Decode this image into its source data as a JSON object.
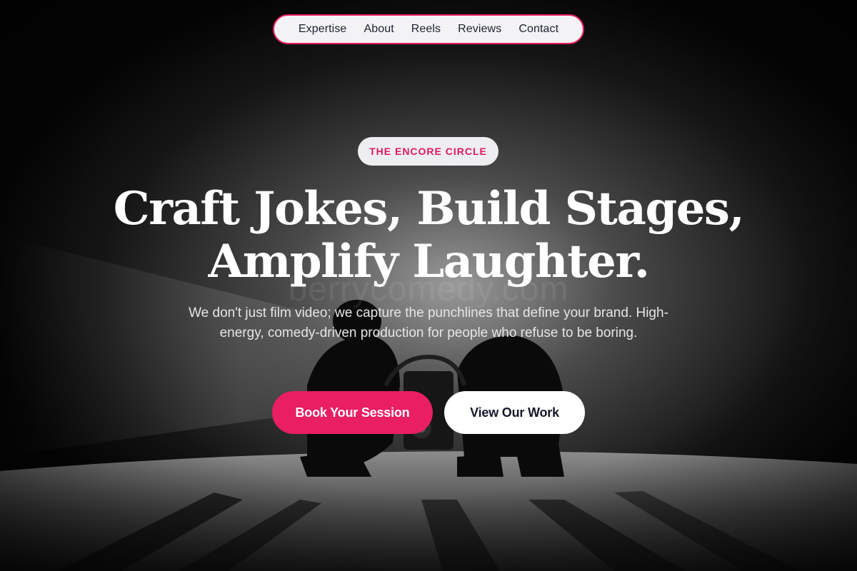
{
  "nav": {
    "links": [
      "Expertise",
      "About",
      "Reels",
      "Reviews",
      "Contact"
    ]
  },
  "hero": {
    "badge": "THE ENCORE CIRCLE",
    "headline_line1": "Craft Jokes, Build Stages,",
    "headline_line2": "Amplify Laughter.",
    "watermark": "berrycomedy.com",
    "subtitle": "We don't just film video; we capture the punchlines that define your brand. High-energy, comedy-driven production for people who refuse to be boring.",
    "primary_cta": "Book Your Session",
    "secondary_cta": "View Our Work",
    "background_image": "black-and-white photo of a camera operator crouched with a gimbal rig on a spotlit stage"
  },
  "colors": {
    "accent": "#e91e63",
    "nav_bg": "#f3f3f5",
    "text_dark": "#15192a"
  }
}
